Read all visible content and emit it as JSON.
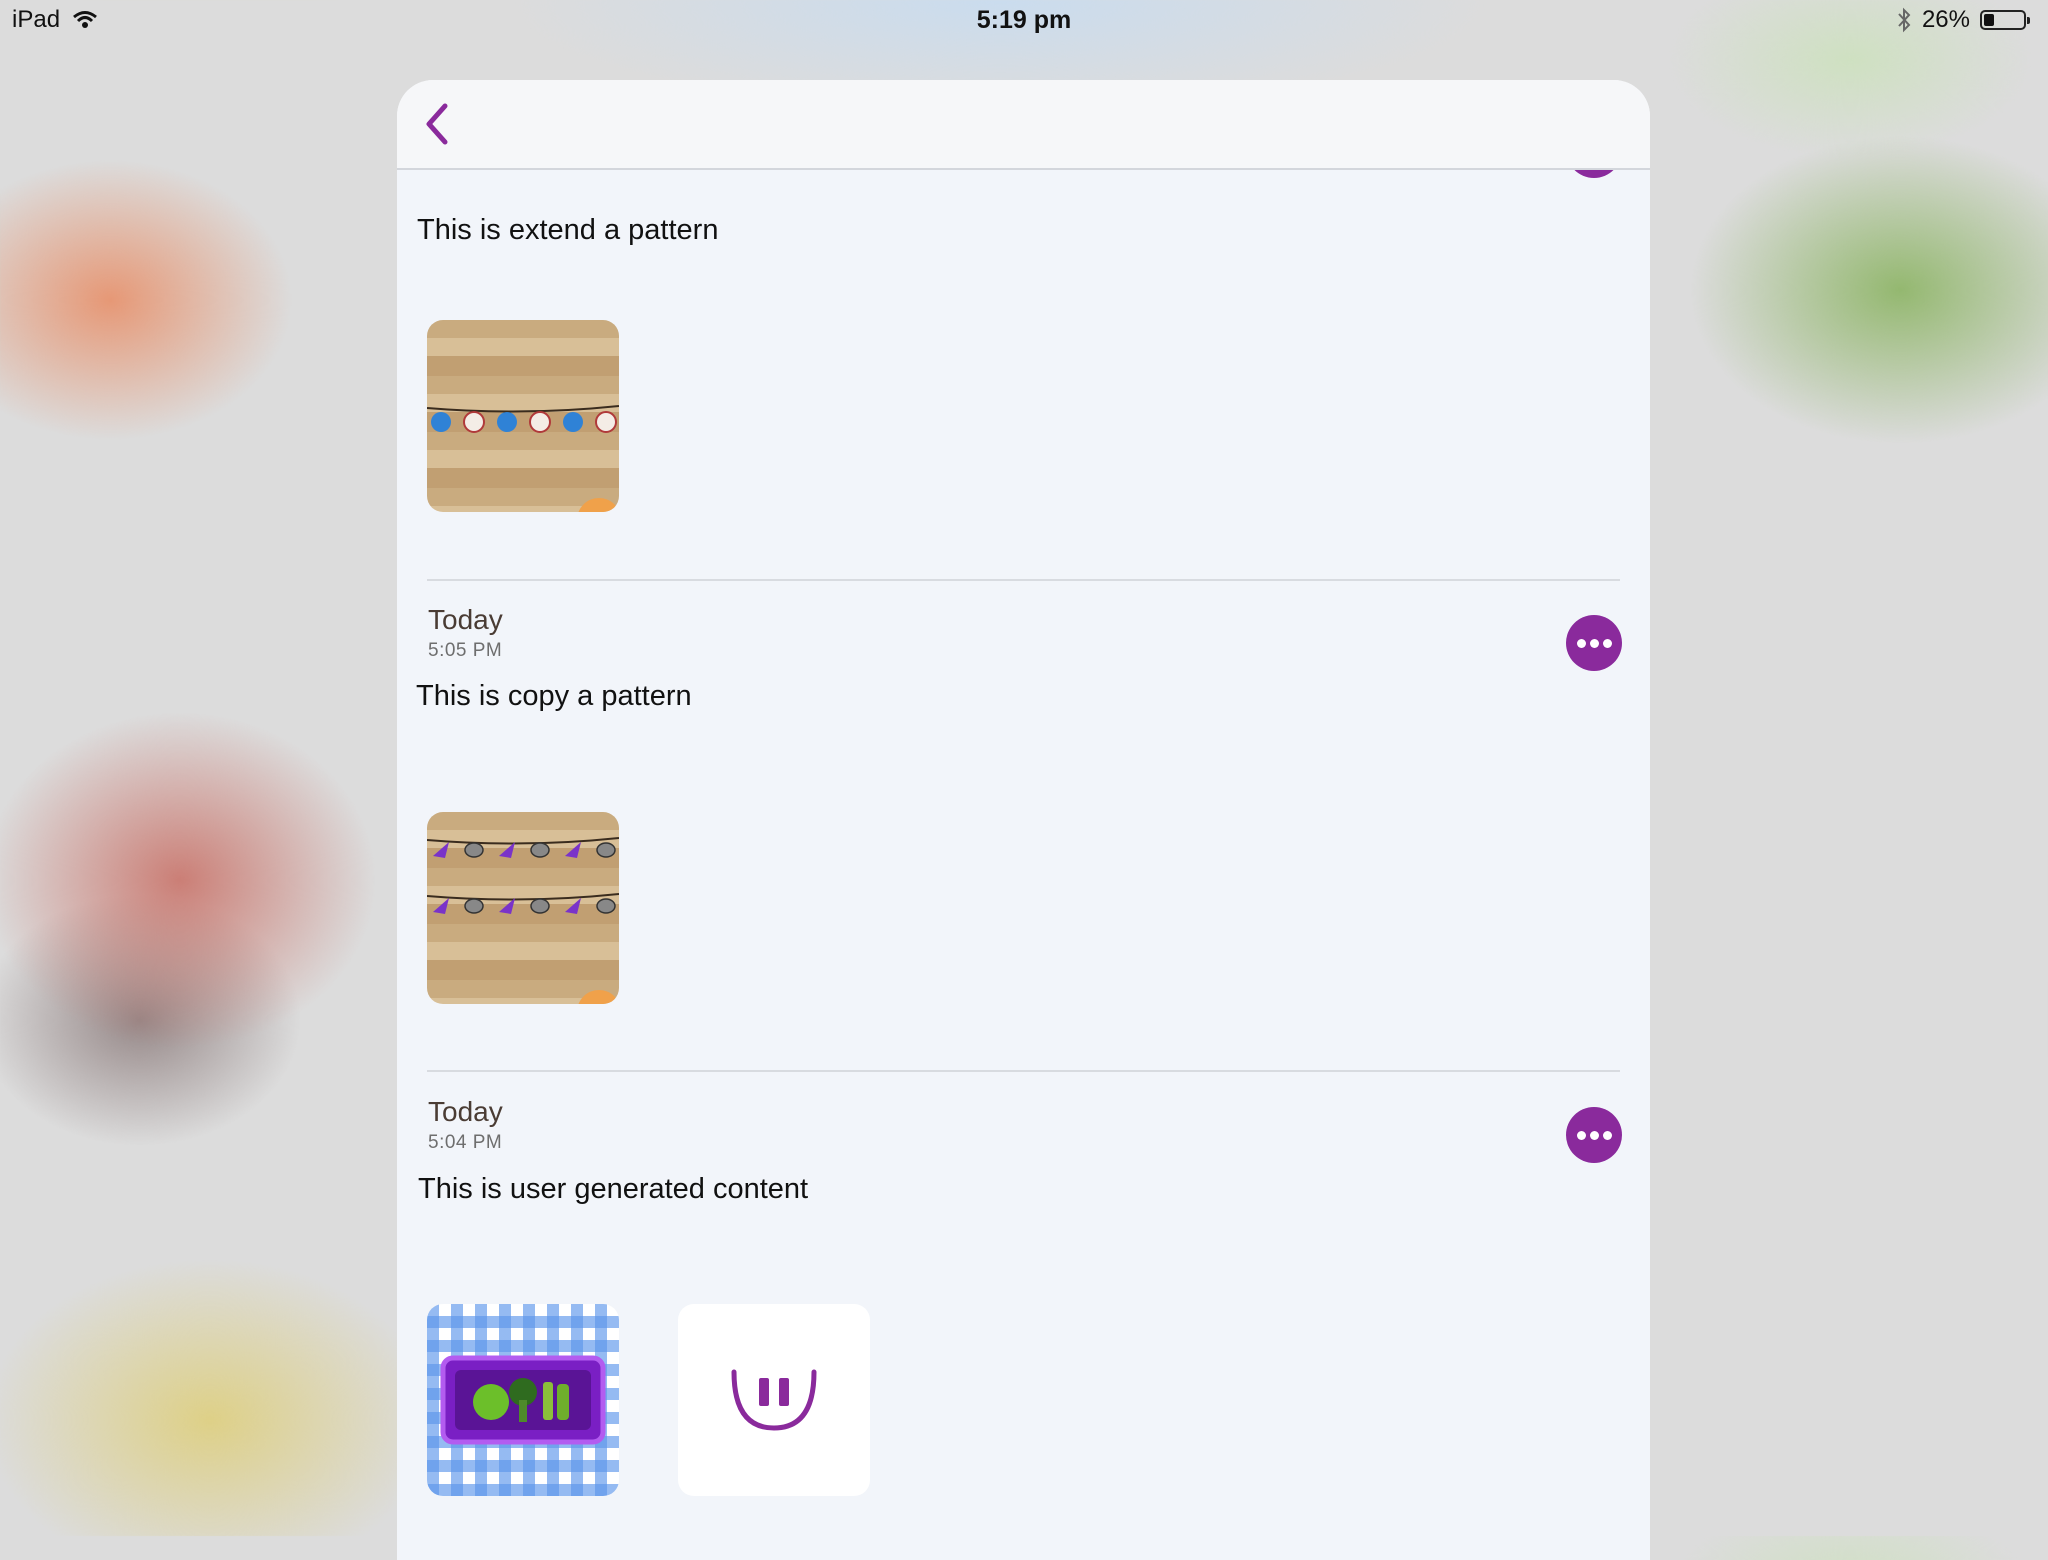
{
  "status_bar": {
    "device": "iPad",
    "time": "5:19 pm",
    "battery": "26%",
    "battery_level": 0.26
  },
  "navbar": {
    "back_icon": "chevron-left-icon",
    "accent_color": "#8a2a9c"
  },
  "entries": [
    {
      "text": "This is extend a pattern",
      "attachments": [
        {
          "type": "image",
          "kind": "pattern-thumbnail"
        }
      ]
    },
    {
      "date": "Today",
      "time": "5:05 PM",
      "text": "This is copy a pattern",
      "more_icon": "ellipsis-icon",
      "attachments": [
        {
          "type": "image",
          "kind": "pattern-thumbnail"
        }
      ]
    },
    {
      "date": "Today",
      "time": "5:04 PM",
      "text": "This is user generated content",
      "more_icon": "ellipsis-icon",
      "attachments": [
        {
          "type": "image",
          "kind": "fruit-veg-thumbnail"
        },
        {
          "type": "audio",
          "icon": "pause-icon"
        }
      ]
    }
  ]
}
